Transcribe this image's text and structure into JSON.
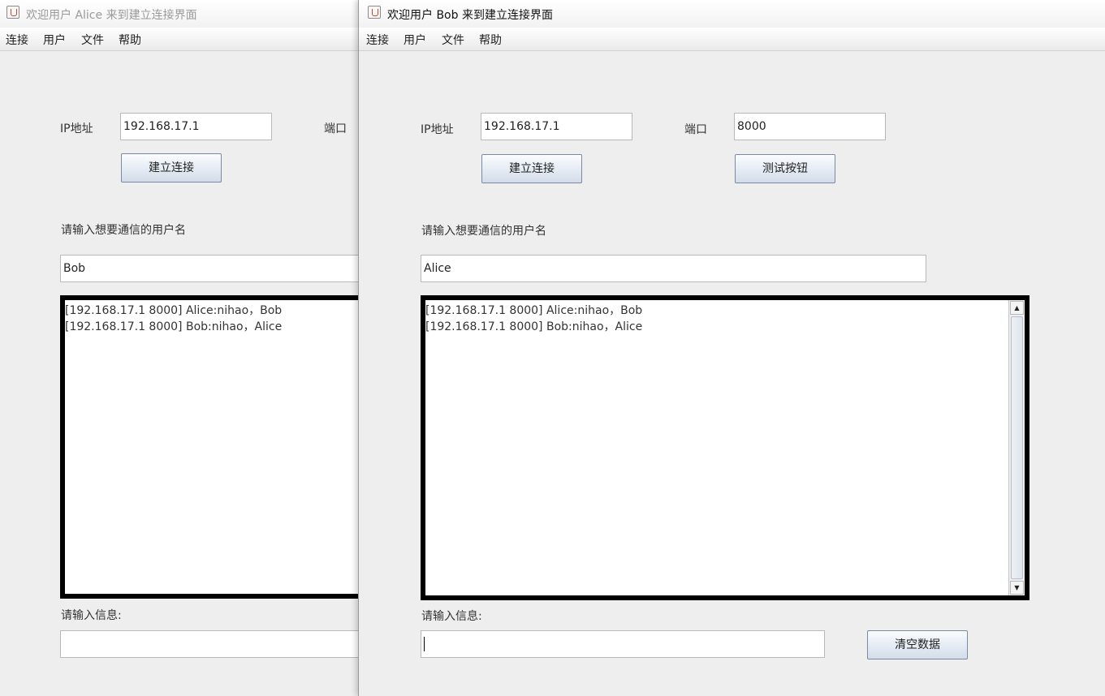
{
  "alice_window": {
    "title": "欢迎用户 Alice 来到建立连接界面",
    "menu": [
      "连接",
      "用户",
      "文件",
      "帮助"
    ],
    "ip_label": "IP地址",
    "ip_value": "192.168.17.1",
    "port_label": "端口",
    "connect_button": "建立连接",
    "target_prompt": "请输入想要通信的用户名",
    "target_user": "Bob",
    "messages": [
      "[192.168.17.1 8000] Alice:nihao，Bob",
      "[192.168.17.1 8000] Bob:nihao，Alice"
    ],
    "message_label": "请输入信息:",
    "message_input": ""
  },
  "bob_window": {
    "title": "欢迎用户 Bob 来到建立连接界面",
    "menu": [
      "连接",
      "用户",
      "文件",
      "帮助"
    ],
    "ip_label": "IP地址",
    "ip_value": "192.168.17.1",
    "port_label": "端口",
    "port_value": "8000",
    "connect_button": "建立连接",
    "test_button": "测试按钮",
    "target_prompt": "请输入想要通信的用户名",
    "target_user": "Alice",
    "messages": [
      "[192.168.17.1 8000] Alice:nihao，Bob",
      "[192.168.17.1 8000] Bob:nihao，Alice"
    ],
    "message_label": "请输入信息:",
    "message_input": "",
    "clear_button": "清空数据"
  },
  "icons": {
    "window_icon": "java-app-icon",
    "scroll_up": "scroll-up-arrow-icon",
    "scroll_down": "scroll-down-arrow-icon"
  }
}
